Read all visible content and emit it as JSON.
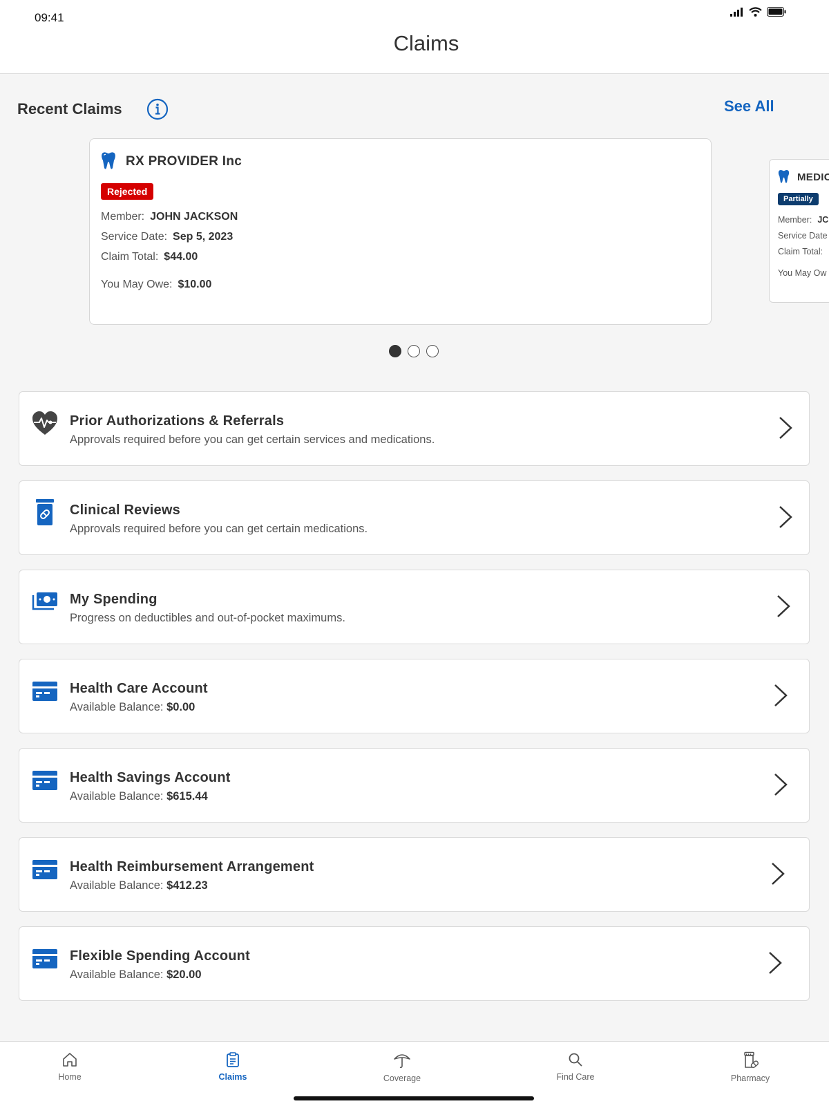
{
  "status_bar": {
    "time": "09:41",
    "icons": [
      "signal-icon",
      "wifi-icon",
      "battery-icon"
    ]
  },
  "header": {
    "title": "Claims"
  },
  "recent_claims": {
    "title": "Recent Claims",
    "see_all_label": "See All",
    "cards": [
      {
        "provider": "RX PROVIDER Inc",
        "status": "Rejected",
        "status_color": "#d50000",
        "member_label": "Member:",
        "member_value": "JOHN JACKSON",
        "service_date_label": "Service Date:",
        "service_date_value": "Sep 5, 2023",
        "claim_total_label": "Claim Total:",
        "claim_total_value": "$44.00",
        "owe_label": "You May Owe:",
        "owe_value": "$10.00"
      },
      {
        "provider": "MEDIC",
        "status": "Partially",
        "status_color": "#0d3c6e",
        "member_label": "Member:",
        "member_value": "JC",
        "service_date_label": "Service Date",
        "claim_total_label": "Claim Total:",
        "owe_label": "You May Ow"
      }
    ],
    "page_count": 3,
    "active_page": 1
  },
  "list_items": [
    {
      "icon": "heart-pulse-icon",
      "title": "Prior Authorizations & Referrals",
      "subtitle": "Approvals required before you can get certain services and medications."
    },
    {
      "icon": "pill-bottle-icon",
      "title": "Clinical Reviews",
      "subtitle": "Approvals required before you can get certain medications."
    },
    {
      "icon": "money-icon",
      "title": "My Spending",
      "subtitle": "Progress on deductibles and out-of-pocket maximums."
    },
    {
      "icon": "card-icon",
      "title": "Health Care Account",
      "balance_label": "Available Balance:",
      "balance_value": "$0.00"
    },
    {
      "icon": "card-icon",
      "title": "Health Savings Account",
      "balance_label": "Available Balance:",
      "balance_value": "$615.44"
    },
    {
      "icon": "card-icon",
      "title": "Health Reimbursement Arrangement",
      "balance_label": "Available Balance:",
      "balance_value": "$412.23"
    },
    {
      "icon": "card-icon",
      "title": "Flexible Spending Account",
      "balance_label": "Available Balance:",
      "balance_value": "$20.00"
    }
  ],
  "tabbar": {
    "active": "Claims",
    "tabs": [
      {
        "label": "Home",
        "icon": "home-icon"
      },
      {
        "label": "Claims",
        "icon": "clipboard-icon"
      },
      {
        "label": "Coverage",
        "icon": "umbrella-icon"
      },
      {
        "label": "Find Care",
        "icon": "search-icon"
      },
      {
        "label": "Pharmacy",
        "icon": "pharmacy-icon"
      }
    ]
  },
  "colors": {
    "accent": "#1565c0",
    "rejected": "#d50000",
    "partial": "#0d3c6e"
  }
}
